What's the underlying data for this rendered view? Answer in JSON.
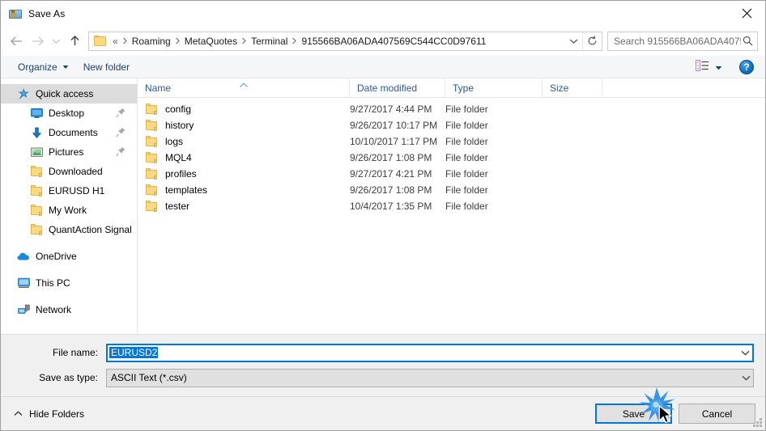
{
  "window": {
    "title": "Save As",
    "app_icon": "save-as-folder-person-icon",
    "close_label": "✕"
  },
  "navigation": {
    "back": "back-arrow-icon",
    "forward": "forward-arrow-icon",
    "recent": "chevron-down-icon",
    "up": "up-arrow-icon"
  },
  "address": {
    "folder_icon": "folder-icon",
    "overflow": "«",
    "separator": "›",
    "crumbs": [
      "Roaming",
      "MetaQuotes",
      "Terminal",
      "915566BA06ADA407569C544CC0D97611"
    ],
    "dropdown_icon": "chevron-down-icon",
    "refresh_icon": "refresh-icon"
  },
  "search": {
    "placeholder": "Search 915566BA06ADA40756...",
    "value": "",
    "icon": "search-icon"
  },
  "toolbar": {
    "organize_label": "Organize",
    "organize_caret": "▾",
    "new_folder_label": "New folder",
    "view_icon": "view-layout-icon",
    "view_caret": "▾",
    "help_label": "?"
  },
  "sidebar": {
    "groups": [
      {
        "header": {
          "label": "Quick access",
          "icon": "star-pin-icon",
          "selected": true
        },
        "items": [
          {
            "label": "Desktop",
            "icon": "desktop-icon",
            "pinned": true
          },
          {
            "label": "Documents",
            "icon": "documents-download-icon",
            "pinned": true
          },
          {
            "label": "Pictures",
            "icon": "pictures-icon",
            "pinned": true
          },
          {
            "label": "Downloaded",
            "icon": "folder-icon",
            "pinned": false
          },
          {
            "label": "EURUSD H1",
            "icon": "folder-icon",
            "pinned": false
          },
          {
            "label": "My Work",
            "icon": "folder-icon",
            "pinned": false
          },
          {
            "label": "QuantAction Signal",
            "icon": "folder-icon",
            "pinned": false
          }
        ]
      },
      {
        "header": {
          "label": "OneDrive",
          "icon": "onedrive-cloud-icon",
          "selected": false
        },
        "items": []
      },
      {
        "header": {
          "label": "This PC",
          "icon": "this-pc-monitor-icon",
          "selected": false
        },
        "items": []
      },
      {
        "header": {
          "label": "Network",
          "icon": "network-icon",
          "selected": false
        },
        "items": []
      }
    ]
  },
  "filelist": {
    "columns": [
      "Name",
      "Date modified",
      "Type",
      "Size"
    ],
    "sort_column": "Name",
    "sort_direction": "ascending",
    "sort_caret": "⌃",
    "rows": [
      {
        "name": "config",
        "date": "9/27/2017 4:44 PM",
        "type": "File folder",
        "size": ""
      },
      {
        "name": "history",
        "date": "9/26/2017 10:17 PM",
        "type": "File folder",
        "size": ""
      },
      {
        "name": "logs",
        "date": "10/10/2017 1:17 PM",
        "type": "File folder",
        "size": ""
      },
      {
        "name": "MQL4",
        "date": "9/26/2017 1:08 PM",
        "type": "File folder",
        "size": ""
      },
      {
        "name": "profiles",
        "date": "9/27/2017 4:21 PM",
        "type": "File folder",
        "size": ""
      },
      {
        "name": "templates",
        "date": "9/26/2017 1:08 PM",
        "type": "File folder",
        "size": ""
      },
      {
        "name": "tester",
        "date": "10/4/2017 1:35 PM",
        "type": "File folder",
        "size": ""
      }
    ]
  },
  "form": {
    "filename_label": "File name:",
    "filename_value": "EURUSD2",
    "filename_selected": true,
    "savetype_label": "Save as type:",
    "savetype_value": "ASCII Text (*.csv)",
    "dropdown_icon": "chevron-down-icon"
  },
  "footer": {
    "hide_folders_label": "Hide Folders",
    "hide_folders_caret": "⌃",
    "save_label": "Save",
    "cancel_label": "Cancel"
  },
  "colors": {
    "accent": "#0078d7",
    "selection": "#0078d7",
    "column_header_text": "#2b5797",
    "toolbar_text": "#1b3f6e",
    "folder_yellow": "#fcd97f",
    "chrome_bg": "#f0f0f0"
  },
  "pointer": {
    "click_indicator": "click-burst",
    "cursor": "mouse-pointer"
  }
}
